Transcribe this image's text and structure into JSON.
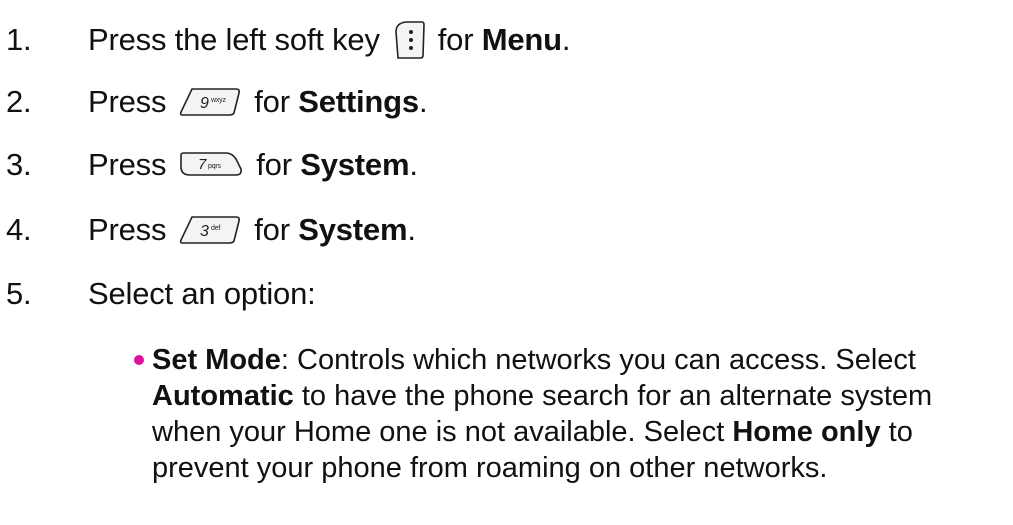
{
  "steps": [
    {
      "number": "1.",
      "before": "Press the left soft key",
      "after": "for",
      "bold": "Menu",
      "end": ".",
      "key_icon": "left-soft-key-icon"
    },
    {
      "number": "2.",
      "before": "Press",
      "after": "for",
      "bold": "Settings",
      "end": ".",
      "key_icon": "key-9-wxyz-icon",
      "key_label": "9",
      "key_sub": "wxyz"
    },
    {
      "number": "3.",
      "before": "Press",
      "after": "for",
      "bold": "System",
      "end": ".",
      "key_icon": "key-7-pqrs-icon",
      "key_label": "7",
      "key_sub": "pqrs"
    },
    {
      "number": "4.",
      "before": "Press",
      "after": "for",
      "bold": "System",
      "end": ".",
      "key_icon": "key-3-def-icon",
      "key_label": "3",
      "key_sub": "def"
    },
    {
      "number": "5.",
      "text": "Select an option:"
    }
  ],
  "bullet": {
    "term": "Set Mode",
    "l1": ": Controls which networks you can access. Select",
    "auto": "Automatic",
    "l2": " to have the phone search for an alternate system",
    "l3a": "when your Home one is not available. Select ",
    "home": "Home only",
    "l3b": " to",
    "l4": "prevent your phone from roaming on other networks.",
    "bullet_color": "#e0109a"
  }
}
